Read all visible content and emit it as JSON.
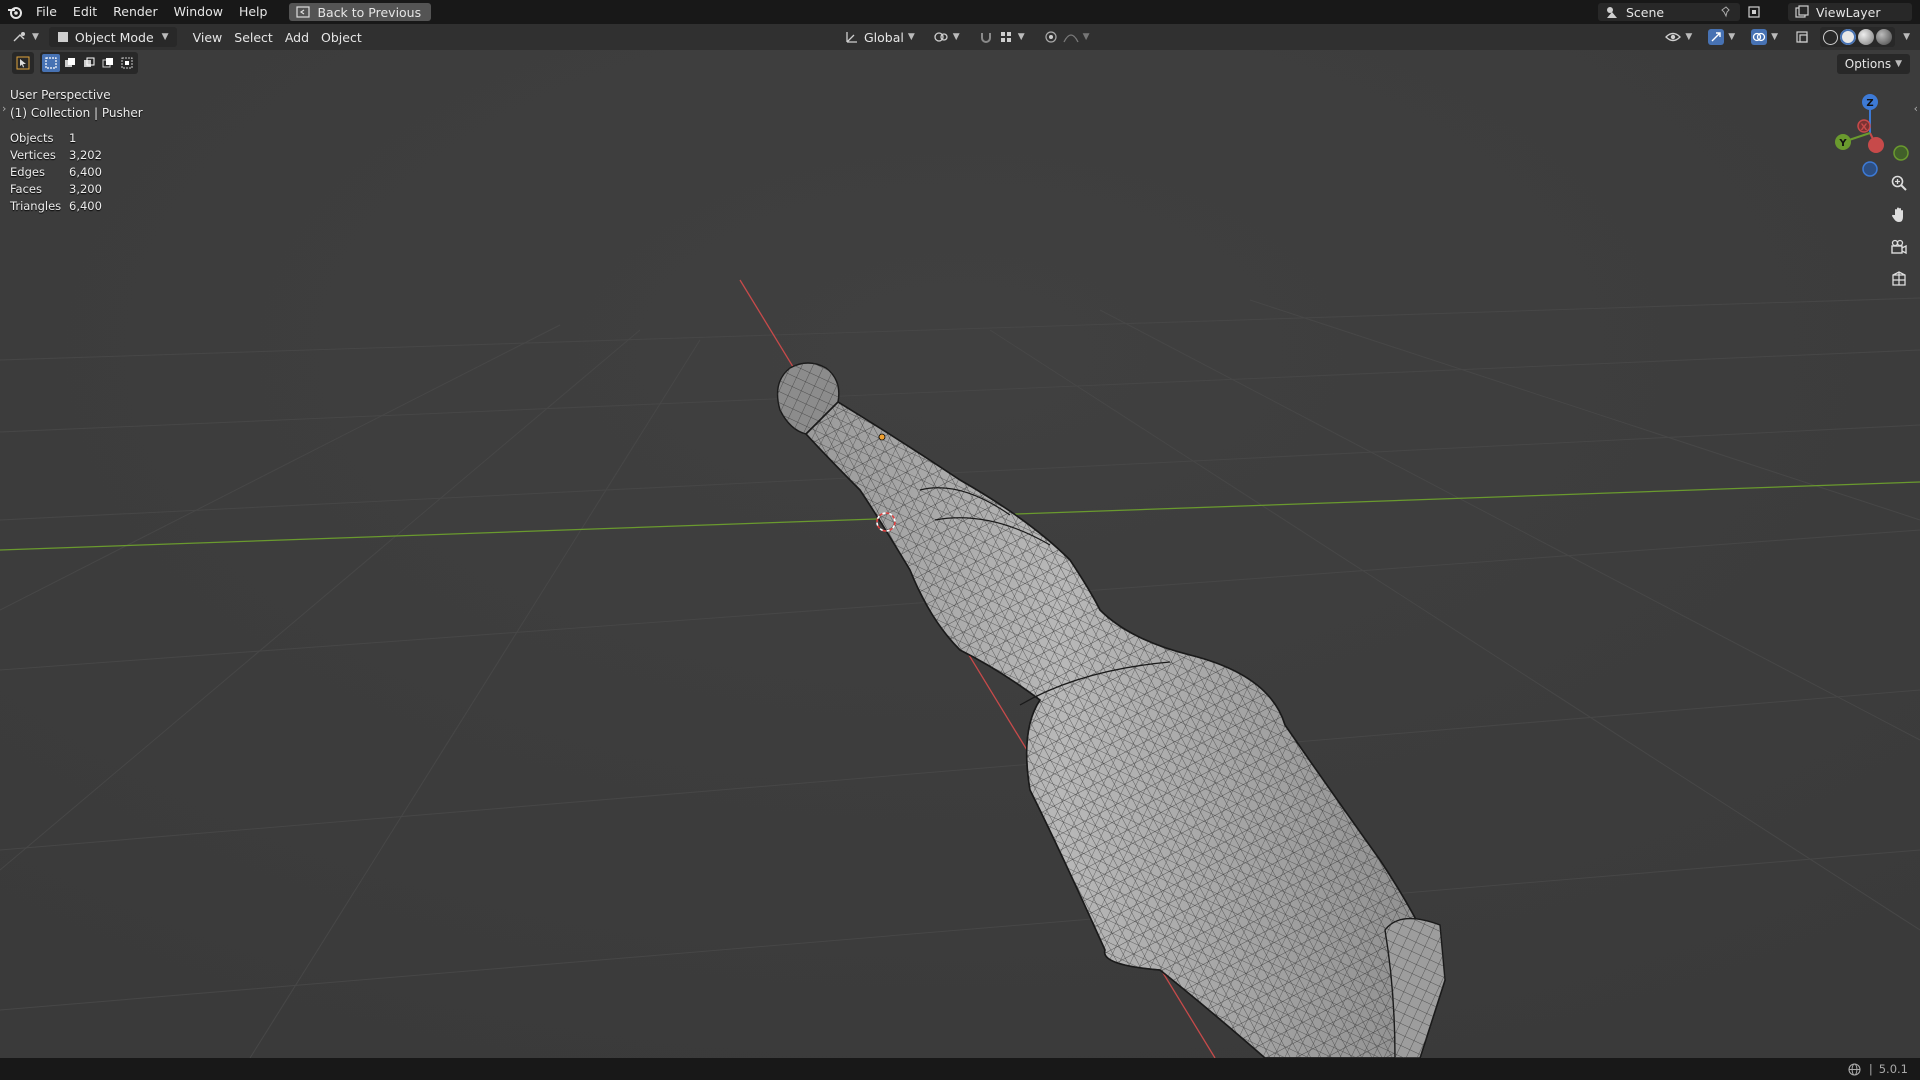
{
  "topbar": {
    "menu": [
      "File",
      "Edit",
      "Render",
      "Window",
      "Help"
    ],
    "back_button": "Back to Previous",
    "scene": "Scene",
    "view_layer": "ViewLayer"
  },
  "header": {
    "mode": "Object Mode",
    "menus": [
      "View",
      "Select",
      "Add",
      "Object"
    ],
    "orientation": "Global",
    "options": "Options"
  },
  "viewport": {
    "perspective": "User Perspective",
    "collection": "(1) Collection | Pusher"
  },
  "stats": [
    {
      "label": "Objects",
      "value": "1"
    },
    {
      "label": "Vertices",
      "value": "3,202"
    },
    {
      "label": "Edges",
      "value": "6,400"
    },
    {
      "label": "Faces",
      "value": "3,200"
    },
    {
      "label": "Triangles",
      "value": "6,400"
    }
  ],
  "gizmo": {
    "z": "Z",
    "y": "Y",
    "x": "X"
  },
  "statusbar": {
    "version": "5.0.1"
  },
  "colors": {
    "x_axis": "#c74a4a",
    "y_axis": "#6a9a2e",
    "z_axis": "#3d7ad6",
    "active": "#4772b3"
  },
  "icons": [
    "blender-logo-icon",
    "back-icon",
    "scene-icon",
    "pin-icon",
    "new-scene-icon",
    "view-layer-icon",
    "editor-type-icon",
    "object-mode-icon",
    "transform-orientation-icon",
    "pivot-icon",
    "snap-icon",
    "proportional-icon",
    "visibility-icon",
    "gizmo-icon",
    "overlay-icon",
    "xray-icon",
    "wireframe-shading-icon",
    "solid-shading-icon",
    "material-shading-icon",
    "rendered-shading-icon",
    "zoom-icon",
    "hand-pan-icon",
    "camera-icon",
    "grid-ortho-icon",
    "globe-icon"
  ]
}
